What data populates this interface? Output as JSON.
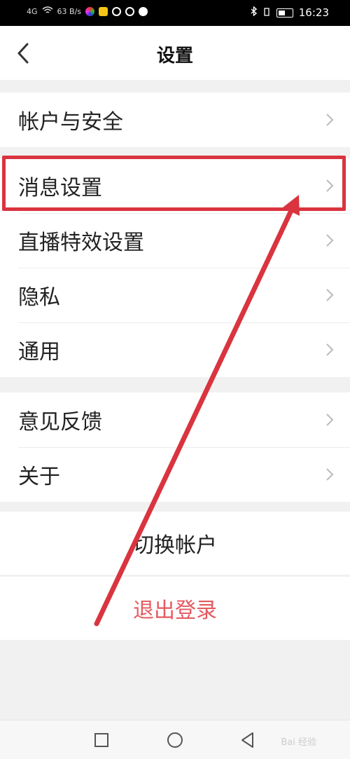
{
  "status_bar": {
    "signal_text": "4G",
    "net_speed": "63 B/s",
    "time": "16:23",
    "icons": [
      "signal-icon",
      "wifi-icon",
      "bluetooth-icon",
      "vibrate-icon",
      "battery-icon"
    ]
  },
  "header": {
    "title": "设置",
    "back_icon": "chevron-left-icon"
  },
  "groups": [
    {
      "items": [
        {
          "label": "帐户与安全"
        }
      ]
    },
    {
      "items": [
        {
          "label": "消息设置",
          "highlighted": true
        },
        {
          "label": "直播特效设置"
        },
        {
          "label": "隐私"
        },
        {
          "label": "通用"
        }
      ]
    },
    {
      "items": [
        {
          "label": "意见反馈"
        },
        {
          "label": "关于"
        }
      ]
    }
  ],
  "actions": {
    "switch_account": "切换帐户",
    "logout": "退出登录"
  },
  "colors": {
    "accent_red": "#d9343f",
    "logout_text": "#e35a5f",
    "background": "#f1f1f1"
  },
  "nav_bar": {
    "icons": [
      "recent-apps-icon",
      "home-icon",
      "back-triangle-icon"
    ],
    "watermark": "Bai 经验"
  }
}
